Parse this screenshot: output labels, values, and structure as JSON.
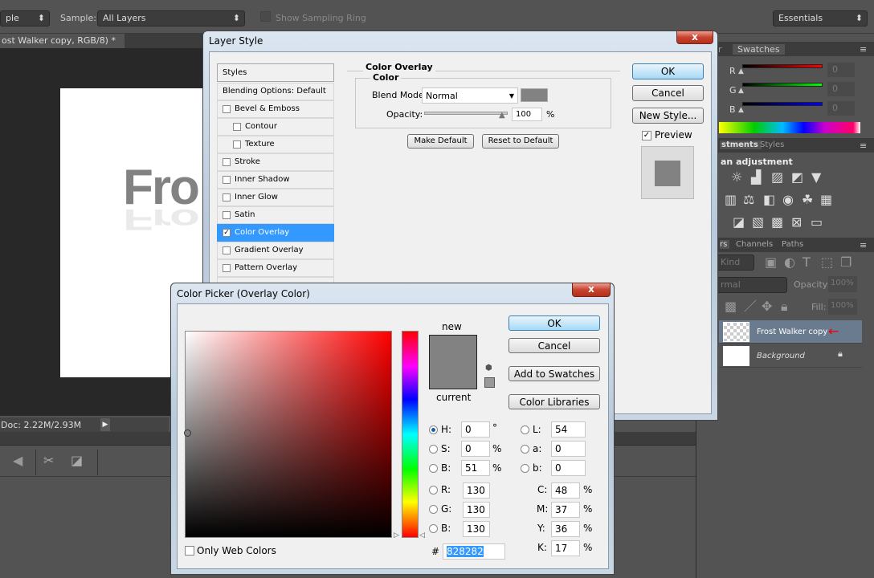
{
  "options_bar": {
    "mode_value": "ple",
    "sample_label": "Sample:",
    "sample_value": "All Layers",
    "sampling_ring_label": "Show Sampling Ring",
    "workspace": "Essentials"
  },
  "document": {
    "tab_title": "ost Walker copy, RGB/8) *",
    "tab_close": "×",
    "canvas_text": "Fro",
    "status": "Doc: 2.22M/2.93M"
  },
  "right_panel": {
    "color_tabs": [
      "r",
      "Swatches"
    ],
    "channels": [
      {
        "label": "R",
        "value": "0",
        "color": "#ff0000"
      },
      {
        "label": "G",
        "value": "0",
        "color": "#00ff00"
      },
      {
        "label": "B",
        "value": "0",
        "color": "#0000ff"
      }
    ],
    "adjust_tabs": [
      "stments",
      "Styles"
    ],
    "adjust_heading": "an adjustment",
    "layers_tabs": [
      "rs",
      "Channels",
      "Paths"
    ],
    "kind": "Kind",
    "blend": "rmal",
    "opacity_label": "Opacity:",
    "opacity": "100%",
    "fill_label": "Fill:",
    "fill": "100%",
    "layers": [
      {
        "name": "Frost Walker copy",
        "selected": true
      },
      {
        "name": "Background",
        "locked": true
      }
    ]
  },
  "layer_style": {
    "title": "Layer Style",
    "close": "x",
    "styles_header": "Styles",
    "items": [
      {
        "label": "Blending Options: Default"
      },
      {
        "label": "Bevel & Emboss",
        "checked": false
      },
      {
        "label": "Contour",
        "checked": false,
        "sub": true
      },
      {
        "label": "Texture",
        "checked": false,
        "sub": true
      },
      {
        "label": "Stroke",
        "checked": false
      },
      {
        "label": "Inner Shadow",
        "checked": false
      },
      {
        "label": "Inner Glow",
        "checked": false
      },
      {
        "label": "Satin",
        "checked": false
      },
      {
        "label": "Color Overlay",
        "checked": true,
        "selected": true
      },
      {
        "label": "Gradient Overlay",
        "checked": false
      },
      {
        "label": "Pattern Overlay",
        "checked": false
      }
    ],
    "section": "Color Overlay",
    "subsection": "Color",
    "blend_mode_label": "Blend Mode:",
    "blend_mode": "Normal",
    "overlay_color": "#828282",
    "opacity_label": "Opacity:",
    "opacity": "100",
    "opacity_unit": "%",
    "make_default": "Make Default",
    "reset_default": "Reset to Default",
    "ok": "OK",
    "cancel": "Cancel",
    "new_style": "New Style...",
    "preview_label": "Preview",
    "preview_checked": true
  },
  "color_picker": {
    "title": "Color Picker (Overlay Color)",
    "close": "x",
    "new_label": "new",
    "current_label": "current",
    "new_color": "#828282",
    "current_color": "#828282",
    "ok": "OK",
    "cancel": "Cancel",
    "add_swatches": "Add to Swatches",
    "libraries": "Color Libraries",
    "fields": {
      "H": {
        "label": "H:",
        "value": "0",
        "unit": "°",
        "selected": true
      },
      "S": {
        "label": "S:",
        "value": "0",
        "unit": "%"
      },
      "Bv": {
        "label": "B:",
        "value": "51",
        "unit": "%"
      },
      "R": {
        "label": "R:",
        "value": "130"
      },
      "G": {
        "label": "G:",
        "value": "130"
      },
      "B": {
        "label": "B:",
        "value": "130"
      },
      "L": {
        "label": "L:",
        "value": "54"
      },
      "a": {
        "label": "a:",
        "value": "0"
      },
      "b": {
        "label": "b:",
        "value": "0"
      },
      "C": {
        "label": "C:",
        "value": "48",
        "unit": "%"
      },
      "M": {
        "label": "M:",
        "value": "37",
        "unit": "%"
      },
      "Y": {
        "label": "Y:",
        "value": "36",
        "unit": "%"
      },
      "K": {
        "label": "K:",
        "value": "17",
        "unit": "%"
      }
    },
    "hash": "#",
    "hex": "828282",
    "web_colors": "Only Web Colors"
  }
}
